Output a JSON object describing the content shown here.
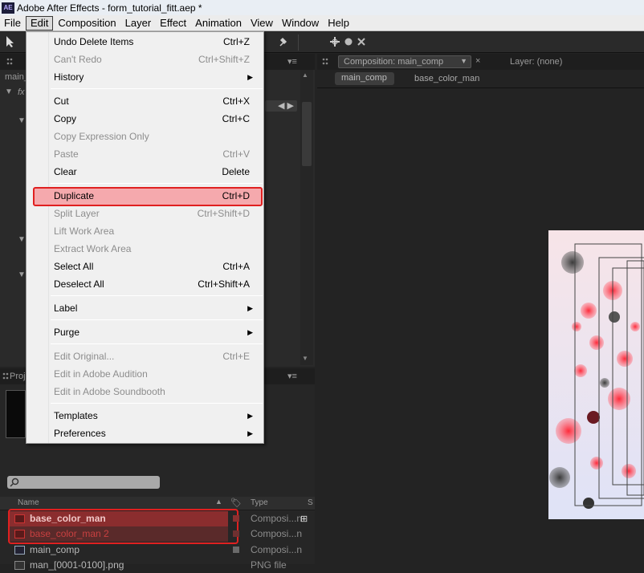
{
  "window": {
    "title": "Adobe After Effects - form_tutorial_fitt.aep *",
    "app_icon": "AE"
  },
  "menubar": [
    "File",
    "Edit",
    "Composition",
    "Layer",
    "Effect",
    "Animation",
    "View",
    "Window",
    "Help"
  ],
  "edit_menu": [
    {
      "label": "Undo Delete Items",
      "shortcut": "Ctrl+Z",
      "enabled": true
    },
    {
      "label": "Can't Redo",
      "shortcut": "Ctrl+Shift+Z",
      "enabled": false
    },
    {
      "label": "History",
      "submenu": true,
      "enabled": true
    },
    {
      "label": "Cut",
      "shortcut": "Ctrl+X",
      "enabled": true
    },
    {
      "label": "Copy",
      "shortcut": "Ctrl+C",
      "enabled": true
    },
    {
      "label": "Copy Expression Only",
      "enabled": false
    },
    {
      "label": "Paste",
      "shortcut": "Ctrl+V",
      "enabled": false
    },
    {
      "label": "Clear",
      "shortcut": "Delete",
      "enabled": true
    },
    {
      "label": "Duplicate",
      "shortcut": "Ctrl+D",
      "enabled": true,
      "highlighted": true
    },
    {
      "label": "Split Layer",
      "shortcut": "Ctrl+Shift+D",
      "enabled": false
    },
    {
      "label": "Lift Work Area",
      "enabled": false
    },
    {
      "label": "Extract Work Area",
      "enabled": false
    },
    {
      "label": "Select All",
      "shortcut": "Ctrl+A",
      "enabled": true
    },
    {
      "label": "Deselect All",
      "shortcut": "Ctrl+Shift+A",
      "enabled": true
    },
    {
      "label": "Label",
      "submenu": true,
      "enabled": true
    },
    {
      "label": "Purge",
      "submenu": true,
      "enabled": true
    },
    {
      "label": "Edit Original...",
      "shortcut": "Ctrl+E",
      "enabled": false
    },
    {
      "label": "Edit in Adobe Audition",
      "enabled": false
    },
    {
      "label": "Edit in Adobe Soundbooth",
      "enabled": false
    },
    {
      "label": "Templates",
      "submenu": true,
      "enabled": true
    },
    {
      "label": "Preferences",
      "submenu": true,
      "enabled": true
    }
  ],
  "composition_panel": {
    "tab": "Composition: main_comp",
    "layer_tab": "Layer: (none)",
    "breadcrumb_active": "main_comp",
    "breadcrumb_next": "base_color_man"
  },
  "left_panel": {
    "label_main": "main_",
    "fx": "fx",
    "project_tab": "Proj"
  },
  "project_columns": {
    "name": "Name",
    "type": "Type",
    "s": "S"
  },
  "project_items": [
    {
      "name": "base_color_man",
      "type": "Composi...n",
      "selected": true
    },
    {
      "name": "base_color_man 2",
      "type": "Composi...n",
      "selected": true
    },
    {
      "name": "main_comp",
      "type": "Composi...n",
      "selected": false
    },
    {
      "name": "man_[0001-0100].png",
      "type": "PNG file",
      "selected": false
    }
  ],
  "colors": {
    "highlight_red": "#e02020",
    "dup_fill": "#f5a9ad",
    "selected_row": "#8a2a2a"
  }
}
